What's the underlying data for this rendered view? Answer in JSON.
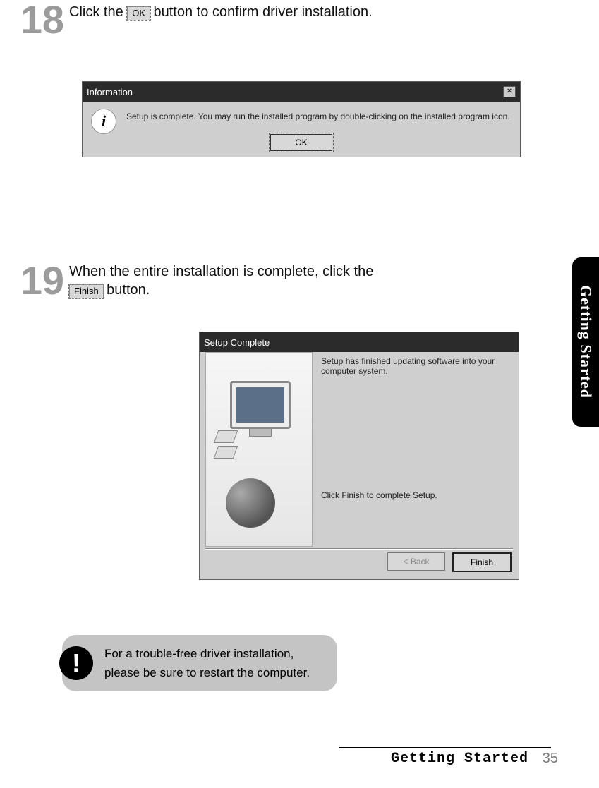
{
  "step18": {
    "num": "18",
    "text_before": "Click the ",
    "btn_label": "OK",
    "text_after": " button to confirm driver installation."
  },
  "dlg_info": {
    "title": "Information",
    "text": "Setup is complete.  You may run the installed program by double-clicking on the installed program icon.",
    "ok_label": "OK",
    "close_label": "×"
  },
  "step19": {
    "num": "19",
    "text_before": "When the entire installation is complete, click the ",
    "btn_label": "Finish",
    "text_after": " button."
  },
  "dlg_setup": {
    "title": "Setup Complete",
    "text1": "Setup has finished updating software into your computer system.",
    "text2": "Click Finish to complete Setup.",
    "back_label": "< Back",
    "finish_label": "Finish"
  },
  "side_tab": "Getting Started",
  "note": {
    "icon": "!",
    "line1": "For a trouble-free driver installation,",
    "line2": "please be sure to restart the computer."
  },
  "footer": {
    "section": "Getting Started",
    "page": "35"
  }
}
